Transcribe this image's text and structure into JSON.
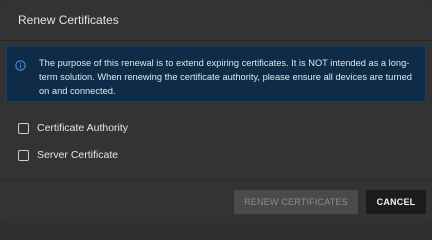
{
  "dialog": {
    "title": "Renew Certificates"
  },
  "banner": {
    "icon": "info-icon",
    "text": "The purpose of this renewal is to extend expiring certificates. It is NOT intended as a long-term solution. When renewing the certificate authority, please ensure all devices are turned on and connected."
  },
  "options": [
    {
      "label": "Certificate Authority",
      "checked": false
    },
    {
      "label": "Server Certificate",
      "checked": false
    }
  ],
  "actions": {
    "renew_label": "RENEW CERTIFICATES",
    "renew_disabled": true,
    "cancel_label": "CANCEL"
  },
  "colors": {
    "dialog_bg": "#333333",
    "banner_bg": "#0e2b47",
    "info_accent": "#3d8fe0",
    "disabled_button_bg": "#4a4a4a",
    "cancel_button_bg": "#1c1c1c"
  }
}
